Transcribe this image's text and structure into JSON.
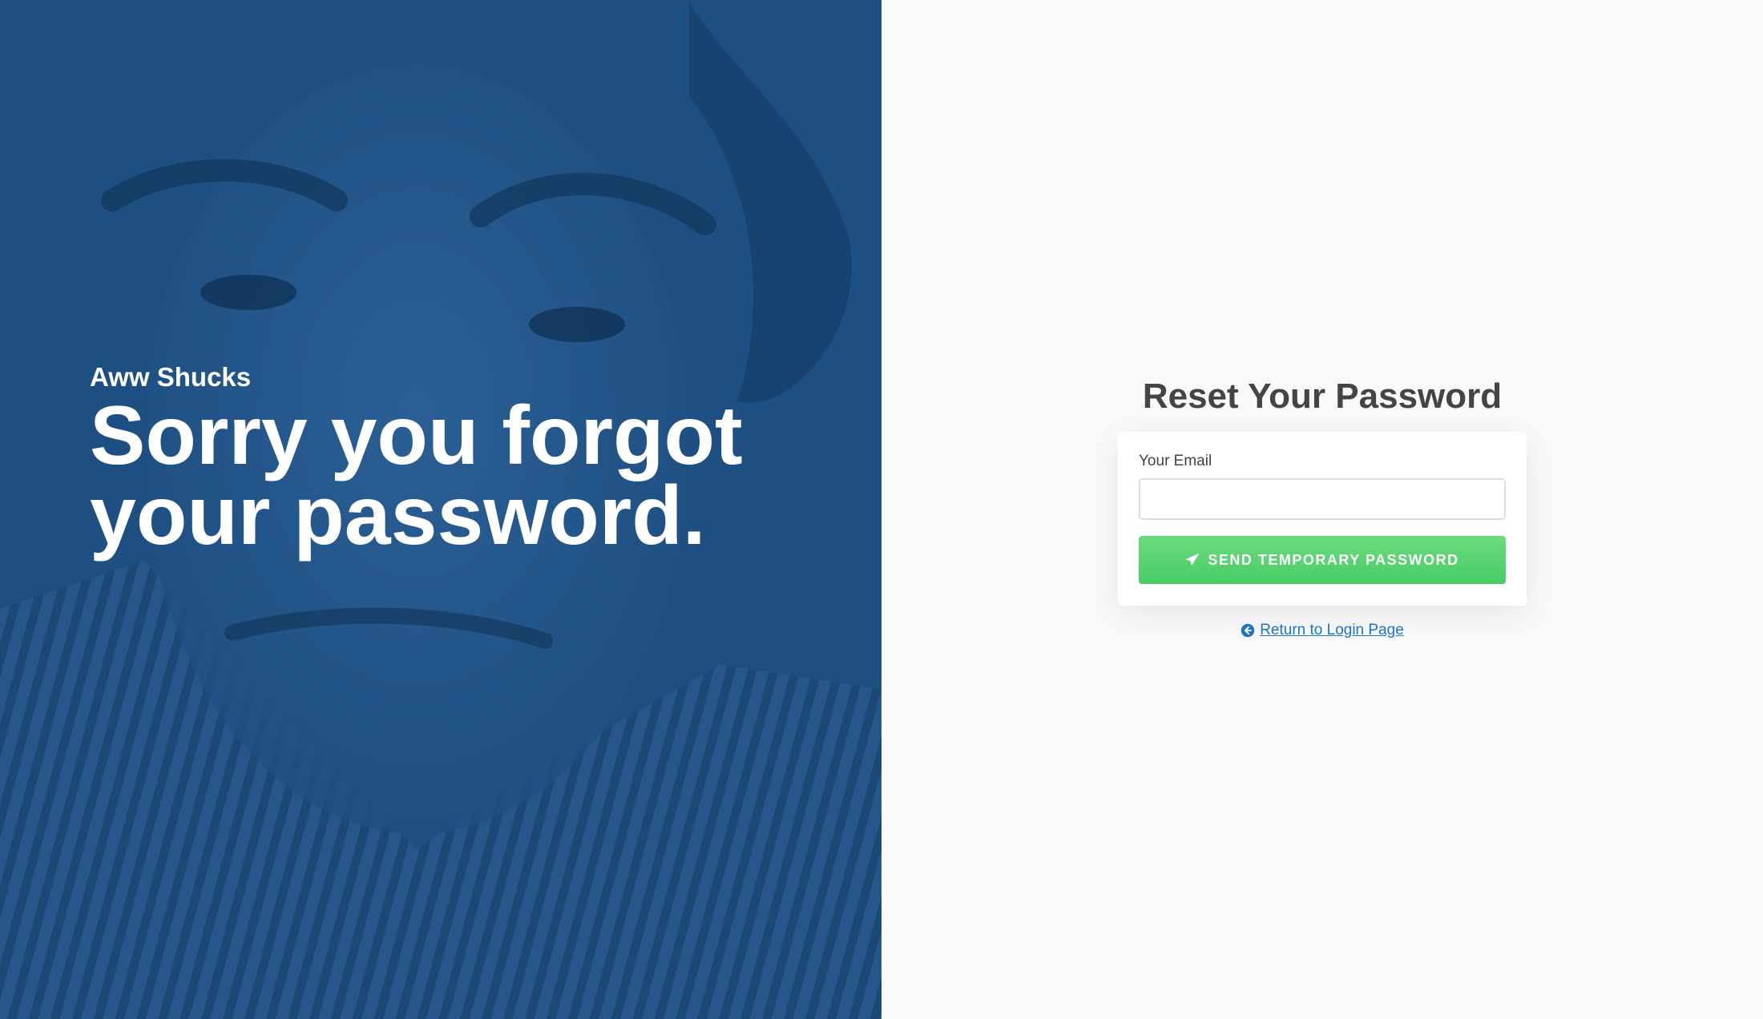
{
  "hero": {
    "eyebrow": "Aww Shucks",
    "title": "Sorry you forgot your password.",
    "overlay_color": "#1d4f82"
  },
  "form": {
    "heading": "Reset Your Password",
    "email_label": "Your Email",
    "email_value": "",
    "email_placeholder": "",
    "send_button_label": "SEND TEMPORARY PASSWORD",
    "send_button_icon": "paper-plane-icon",
    "button_color": "#4ccf68",
    "return_link_label": "Return to Login Page",
    "return_link_icon": "arrow-circle-left-icon",
    "link_color": "#1b75c9"
  }
}
